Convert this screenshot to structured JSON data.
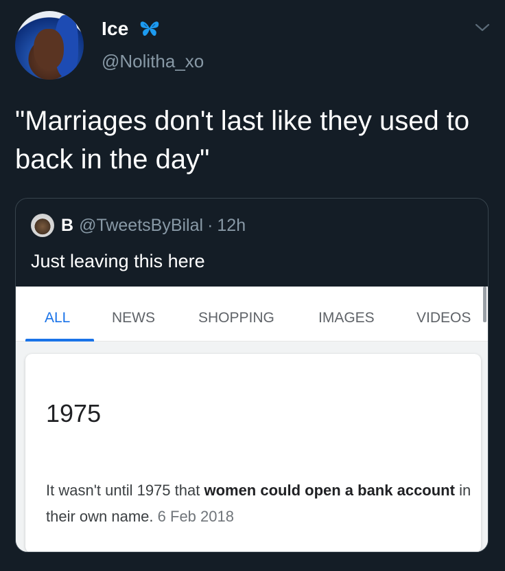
{
  "tweet": {
    "display_name": "Ice",
    "badge_icon": "butterfly-icon",
    "handle": "@Nolitha_xo",
    "text": "\"Marriages don't last like they used to back in the day\""
  },
  "quoted_tweet": {
    "display_name": "B",
    "handle": "@TweetsByBilal",
    "separator": "·",
    "time": "12h",
    "text": "Just leaving this here"
  },
  "search_screenshot": {
    "tabs": [
      {
        "label": "ALL",
        "active": true
      },
      {
        "label": "NEWS",
        "active": false
      },
      {
        "label": "SHOPPING",
        "active": false
      },
      {
        "label": "IMAGES",
        "active": false
      },
      {
        "label": "VIDEOS",
        "active": false
      }
    ],
    "answer": "1975",
    "snippet_parts": [
      {
        "text": "It wasn't until 1975 that ",
        "bold": false
      },
      {
        "text": "women could open a bank account",
        "bold": true
      },
      {
        "text": " in their own name.",
        "bold": false
      }
    ],
    "snippet_date": "6 Feb 2018"
  },
  "colors": {
    "background": "#141d26",
    "muted_text": "#8899a6",
    "badge_blue": "#1d9bf0",
    "google_blue": "#1a73e8"
  }
}
